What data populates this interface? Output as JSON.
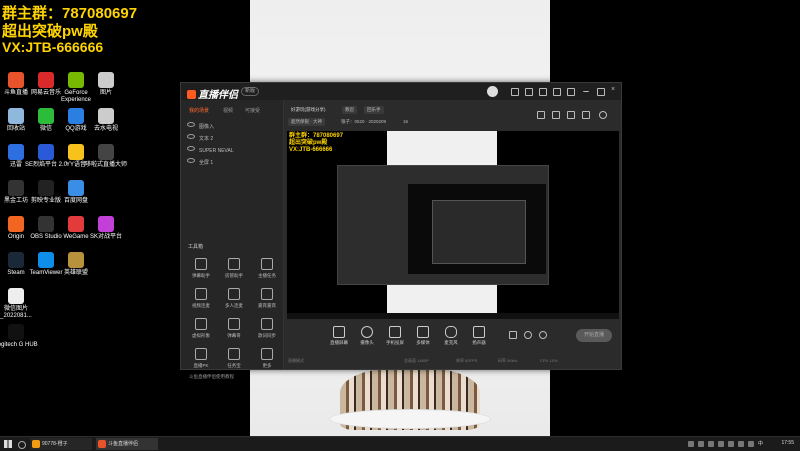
{
  "overlay": {
    "line1": "群主群：787080697",
    "line2": "超出突破pw殿",
    "line3": "VX:JTB-666666"
  },
  "desktop_icons": [
    {
      "label": "斗鱼直播",
      "color": "#e8532b"
    },
    {
      "label": "网易云音乐",
      "color": "#d82a2a"
    },
    {
      "label": "GeForce Experience",
      "color": "#76b900"
    },
    {
      "label": "图片",
      "color": "#cccccc"
    },
    {
      "label": "回收站",
      "color": "#8fb8dd"
    },
    {
      "label": "微信",
      "color": "#2dbb3c"
    },
    {
      "label": "QQ游戏",
      "color": "#2b7fe0"
    },
    {
      "label": "去水电视",
      "color": "#cccccc"
    },
    {
      "label": "迅雷",
      "color": "#2d6fe0"
    },
    {
      "label": "SE烈焰平台 2.0",
      "color": "#2a5ad8"
    },
    {
      "label": "YY语音",
      "color": "#f7c21b"
    },
    {
      "label": "哆啦式直播大师",
      "color": "#444444"
    },
    {
      "label": "黑金工坊",
      "color": "#333333"
    },
    {
      "label": "剪映专业版",
      "color": "#222222"
    },
    {
      "label": "百度网盘",
      "color": "#3a8ee6"
    },
    {
      "label": "Origin",
      "color": "#f26522"
    },
    {
      "label": "OBS Studio",
      "color": "#333333"
    },
    {
      "label": "WeGame",
      "color": "#e33b3b"
    },
    {
      "label": "SK对战平台",
      "color": "#c23fd8"
    },
    {
      "label": "Steam",
      "color": "#1b2838"
    },
    {
      "label": "TeamViewer",
      "color": "#0e8ee9"
    },
    {
      "label": "英雄联盟",
      "color": "#b8913c"
    },
    {
      "label": "微信图片_2022081...",
      "color": "#eeeeee"
    },
    {
      "label": "Logitech G HUB",
      "color": "#111111"
    }
  ],
  "app": {
    "logo": "直播伴侣",
    "version": "新版",
    "left_tabs": [
      "我的场景",
      "视频",
      "可接受"
    ],
    "scenes": [
      "图像入",
      "文本 2",
      "SUPER NEVAL",
      "全屏 1"
    ],
    "tools_title": "工具箱",
    "tools": [
      "弹幕助手",
      "房管助手",
      "主播任务",
      "视频连麦",
      "多人连麦",
      "嘉宾嘉宾",
      "虚拟形象",
      "弹幕哥",
      "歌词同步",
      "直播PK",
      "任务宝",
      "更多"
    ],
    "bottom_label": "斗鱼直播伴侣使用教程",
    "stream_title": "好游玩(游戏分享)",
    "tag1": "教您",
    "tag2": "回乐手",
    "chip1": "超然保银 · 大神",
    "chip2": "银子：0520 · 2020209",
    "chip3": "16",
    "controls": [
      "直播屏幕",
      "摄像头",
      "手机投屏",
      "多媒体",
      "麦克风",
      "扬声器"
    ],
    "go_live": "开始直播",
    "status": [
      "直播模式",
      "总画面 1480P",
      "帧率 60FPS",
      "码率 0Kb/s",
      "CPU 10%"
    ]
  },
  "taskbar": {
    "items": [
      {
        "label": "90778-橙子",
        "color": "#f39c12"
      },
      {
        "label": "斗鱼直播伴侣",
        "color": "#e8532b"
      }
    ],
    "clock": "17:55"
  },
  "colors": {
    "accent": "#ff6b2b",
    "overlay_text": "#ffd400"
  }
}
